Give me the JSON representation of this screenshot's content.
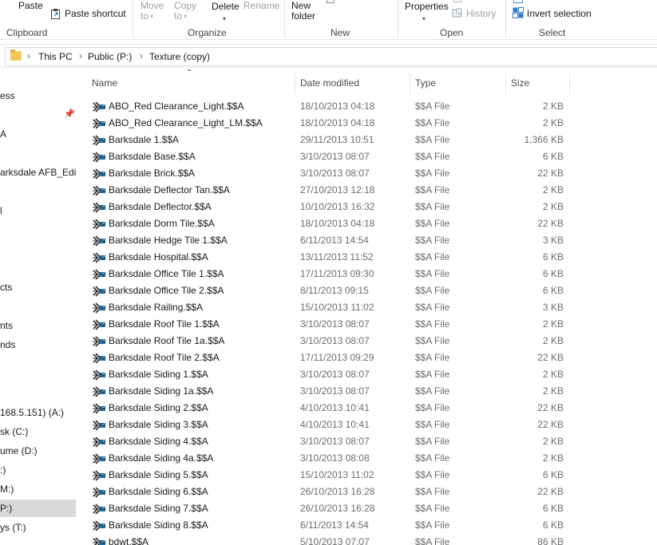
{
  "ribbon": {
    "paste": "Paste",
    "paste_shortcut": "Paste shortcut",
    "clipboard": "Clipboard",
    "move_to": "Move to",
    "copy_to": "Copy to",
    "delete": "Delete",
    "rename": "Rename",
    "organize": "Organize",
    "new_folder": "New folder",
    "new": "New",
    "properties": "Properties",
    "history": "History",
    "open": "Open",
    "invert_selection": "Invert selection",
    "select": "Select"
  },
  "breadcrumb": [
    "This PC",
    "Public (P:)",
    "Texture (copy)"
  ],
  "nav": {
    "items": [
      "ess",
      "A",
      "arksdale AFB_Editi",
      "l",
      "cts",
      "nts",
      "nds",
      "168.5.151) (A:)",
      "sk (C:)",
      "ume (D:)",
      ":)",
      "M:)",
      "P:)",
      "ys (T:)"
    ],
    "selected_index": 12
  },
  "columns": {
    "name": "Name",
    "date": "Date modified",
    "type": "Type",
    "size": "Size"
  },
  "files": [
    {
      "name": "ABO_Red Clearance_Light.$$A",
      "date": "18/10/2013 04:18",
      "type": "$$A File",
      "size": "2 KB"
    },
    {
      "name": "ABO_Red Clearance_Light_LM.$$A",
      "date": "18/10/2013 04:18",
      "type": "$$A File",
      "size": "2 KB"
    },
    {
      "name": "Barksdale 1.$$A",
      "date": "29/11/2013 10:51",
      "type": "$$A File",
      "size": "1,366 KB"
    },
    {
      "name": "Barksdale Base.$$A",
      "date": "3/10/2013 08:07",
      "type": "$$A File",
      "size": "6 KB"
    },
    {
      "name": "Barksdale Brick.$$A",
      "date": "3/10/2013 08:07",
      "type": "$$A File",
      "size": "22 KB"
    },
    {
      "name": "Barksdale Deflector Tan.$$A",
      "date": "27/10/2013 12:18",
      "type": "$$A File",
      "size": "2 KB"
    },
    {
      "name": "Barksdale Deflector.$$A",
      "date": "10/10/2013 16:32",
      "type": "$$A File",
      "size": "2 KB"
    },
    {
      "name": "Barksdale Dorm Tile.$$A",
      "date": "18/10/2013 04:18",
      "type": "$$A File",
      "size": "22 KB"
    },
    {
      "name": "Barksdale Hedge Tile 1.$$A",
      "date": "6/11/2013 14:54",
      "type": "$$A File",
      "size": "3 KB"
    },
    {
      "name": "Barksdale Hospital.$$A",
      "date": "13/11/2013 11:52",
      "type": "$$A File",
      "size": "6 KB"
    },
    {
      "name": "Barksdale Office Tile 1.$$A",
      "date": "17/11/2013 09:30",
      "type": "$$A File",
      "size": "6 KB"
    },
    {
      "name": "Barksdale Office Tile 2.$$A",
      "date": "8/11/2013 09:15",
      "type": "$$A File",
      "size": "6 KB"
    },
    {
      "name": "Barksdale Railing.$$A",
      "date": "15/10/2013 11:02",
      "type": "$$A File",
      "size": "3 KB"
    },
    {
      "name": "Barksdale Roof Tile 1.$$A",
      "date": "3/10/2013 08:07",
      "type": "$$A File",
      "size": "2 KB"
    },
    {
      "name": "Barksdale Roof Tile 1a.$$A",
      "date": "3/10/2013 08:07",
      "type": "$$A File",
      "size": "2 KB"
    },
    {
      "name": "Barksdale Roof Tile 2.$$A",
      "date": "17/11/2013 09:29",
      "type": "$$A File",
      "size": "22 KB"
    },
    {
      "name": "Barksdale Siding 1.$$A",
      "date": "3/10/2013 08:07",
      "type": "$$A File",
      "size": "2 KB"
    },
    {
      "name": "Barksdale Siding 1a.$$A",
      "date": "3/10/2013 08:07",
      "type": "$$A File",
      "size": "2 KB"
    },
    {
      "name": "Barksdale Siding 2.$$A",
      "date": "4/10/2013 10:41",
      "type": "$$A File",
      "size": "22 KB"
    },
    {
      "name": "Barksdale Siding 3.$$A",
      "date": "4/10/2013 10:41",
      "type": "$$A File",
      "size": "22 KB"
    },
    {
      "name": "Barksdale Siding 4.$$A",
      "date": "3/10/2013 08:07",
      "type": "$$A File",
      "size": "2 KB"
    },
    {
      "name": "Barksdale Siding 4a.$$A",
      "date": "3/10/2013 08:08",
      "type": "$$A File",
      "size": "2 KB"
    },
    {
      "name": "Barksdale Siding 5.$$A",
      "date": "15/10/2013 11:02",
      "type": "$$A File",
      "size": "6 KB"
    },
    {
      "name": "Barksdale Siding 6.$$A",
      "date": "26/10/2013 16:28",
      "type": "$$A File",
      "size": "22 KB"
    },
    {
      "name": "Barksdale Siding 7.$$A",
      "date": "26/10/2013 16:28",
      "type": "$$A File",
      "size": "6 KB"
    },
    {
      "name": "Barksdale Siding 8.$$A",
      "date": "6/11/2013 14:54",
      "type": "$$A File",
      "size": "6 KB"
    },
    {
      "name": "bdwt.$$A",
      "date": "5/10/2013 07:07",
      "type": "$$A File",
      "size": "86 KB"
    }
  ]
}
